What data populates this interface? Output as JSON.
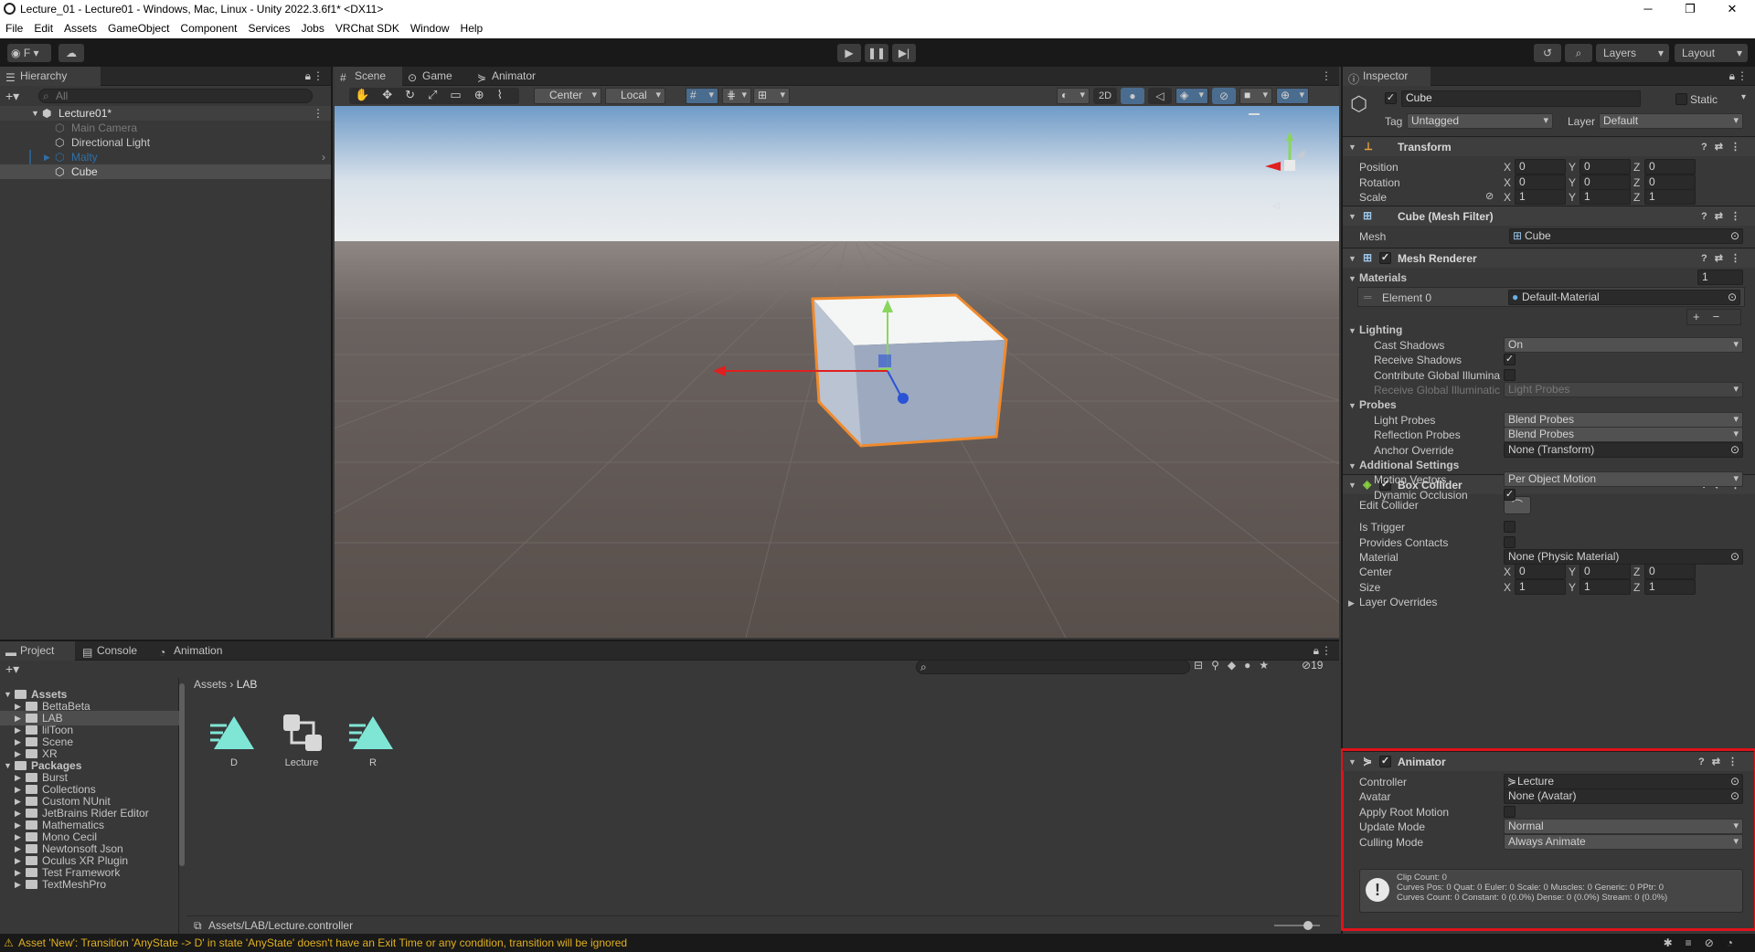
{
  "window": {
    "title": "Lecture_01 - Lecture01 - Windows, Mac, Linux - Unity 2022.3.6f1* <DX11>",
    "minimize": "─",
    "maximize": "❐",
    "close": "✕"
  },
  "menu": [
    "File",
    "Edit",
    "Assets",
    "GameObject",
    "Component",
    "Services",
    "Jobs",
    "VRChat SDK",
    "Window",
    "Help"
  ],
  "toolbar": {
    "account": "F",
    "layers": "Layers",
    "layout": "Layout"
  },
  "hierarchy": {
    "title": "Hierarchy",
    "search_placeholder": "All",
    "scene": "Lecture01*",
    "items": [
      "Main Camera",
      "Directional Light",
      "Malty",
      "Cube"
    ]
  },
  "scene_tabs": [
    "Scene",
    "Game",
    "Animator"
  ],
  "scene_toolbar": {
    "pivot": "Center",
    "space": "Local",
    "mode2d": "2D"
  },
  "project": {
    "tabs": [
      "Project",
      "Console",
      "Animation"
    ],
    "breadcrumb": [
      "Assets",
      "LAB"
    ],
    "tree": [
      {
        "label": "Assets",
        "level": 0,
        "bold": true
      },
      {
        "label": "BettaBeta",
        "level": 1
      },
      {
        "label": "LAB",
        "level": 1,
        "selected": true
      },
      {
        "label": "lilToon",
        "level": 1
      },
      {
        "label": "Scene",
        "level": 1
      },
      {
        "label": "XR",
        "level": 1
      },
      {
        "label": "Packages",
        "level": 0,
        "bold": true
      },
      {
        "label": "Burst",
        "level": 1
      },
      {
        "label": "Collections",
        "level": 1
      },
      {
        "label": "Custom NUnit",
        "level": 1
      },
      {
        "label": "JetBrains Rider Editor",
        "level": 1
      },
      {
        "label": "Mathematics",
        "level": 1
      },
      {
        "label": "Mono Cecil",
        "level": 1
      },
      {
        "label": "Newtonsoft Json",
        "level": 1
      },
      {
        "label": "Oculus XR Plugin",
        "level": 1
      },
      {
        "label": "Test Framework",
        "level": 1
      },
      {
        "label": "TextMeshPro",
        "level": 1
      }
    ],
    "assets": [
      {
        "name": "D",
        "icon": "animation-clip-icon"
      },
      {
        "name": "Lecture",
        "icon": "animator-controller-icon"
      },
      {
        "name": "R",
        "icon": "animation-clip-icon"
      }
    ],
    "hidden_count": "19",
    "path": "Assets/LAB/Lecture.controller"
  },
  "inspector": {
    "title": "Inspector",
    "object_name": "Cube",
    "static_label": "Static",
    "tag_label": "Tag",
    "tag": "Untagged",
    "layer_label": "Layer",
    "layer": "Default",
    "transform": {
      "title": "Transform",
      "rows": [
        {
          "label": "Position",
          "x": "0",
          "y": "0",
          "z": "0"
        },
        {
          "label": "Rotation",
          "x": "0",
          "y": "0",
          "z": "0"
        },
        {
          "label": "Scale",
          "x": "1",
          "y": "1",
          "z": "1"
        }
      ]
    },
    "mesh_filter": {
      "title": "Cube (Mesh Filter)",
      "mesh_label": "Mesh",
      "mesh": "Cube"
    },
    "mesh_renderer": {
      "title": "Mesh Renderer",
      "materials_label": "Materials",
      "materials_count": "1",
      "element_label": "Element 0",
      "element": "Default-Material",
      "lighting_label": "Lighting",
      "cast_shadows_label": "Cast Shadows",
      "cast_shadows": "On",
      "receive_shadows_label": "Receive Shadows",
      "contribute_gi_label": "Contribute Global Illumina",
      "receive_gi_label": "Receive Global Illuminatic",
      "receive_gi": "Light Probes",
      "probes_label": "Probes",
      "light_probes_label": "Light Probes",
      "light_probes": "Blend Probes",
      "reflection_probes_label": "Reflection Probes",
      "reflection_probes": "Blend Probes",
      "anchor_override_label": "Anchor Override",
      "anchor_override": "None (Transform)",
      "additional_label": "Additional Settings",
      "motion_vectors_label": "Motion Vectors",
      "motion_vectors": "Per Object Motion",
      "dynamic_occlusion_label": "Dynamic Occlusion"
    },
    "box_collider": {
      "title": "Box Collider",
      "edit_label": "Edit Collider",
      "trigger_label": "Is Trigger",
      "contacts_label": "Provides Contacts",
      "material_label": "Material",
      "material": "None (Physic Material)",
      "center_label": "Center",
      "center": {
        "x": "0",
        "y": "0",
        "z": "0"
      },
      "size_label": "Size",
      "size": {
        "x": "1",
        "y": "1",
        "z": "1"
      },
      "layer_overrides": "Layer Overrides"
    },
    "animator": {
      "title": "Animator",
      "controller_label": "Controller",
      "controller": "Lecture",
      "avatar_label": "Avatar",
      "avatar": "None (Avatar)",
      "root_motion_label": "Apply Root Motion",
      "update_mode_label": "Update Mode",
      "update_mode": "Normal",
      "culling_mode_label": "Culling Mode",
      "culling_mode": "Always Animate",
      "info": [
        "Clip Count: 0",
        "Curves Pos: 0 Quat: 0 Euler: 0 Scale: 0 Muscles: 0 Generic: 0 PPtr: 0",
        "Curves Count: 0 Constant: 0 (0.0%) Dense: 0 (0.0%) Stream: 0 (0.0%)"
      ]
    }
  },
  "status": {
    "message": "Asset 'New': Transition 'AnyState -> D' in state 'AnyState' doesn't have an Exit Time or any condition, transition will be ignored"
  },
  "colors": {
    "highlight": "#e0121b",
    "selection": "#2c5d87",
    "clip": "#7fe6d6"
  }
}
